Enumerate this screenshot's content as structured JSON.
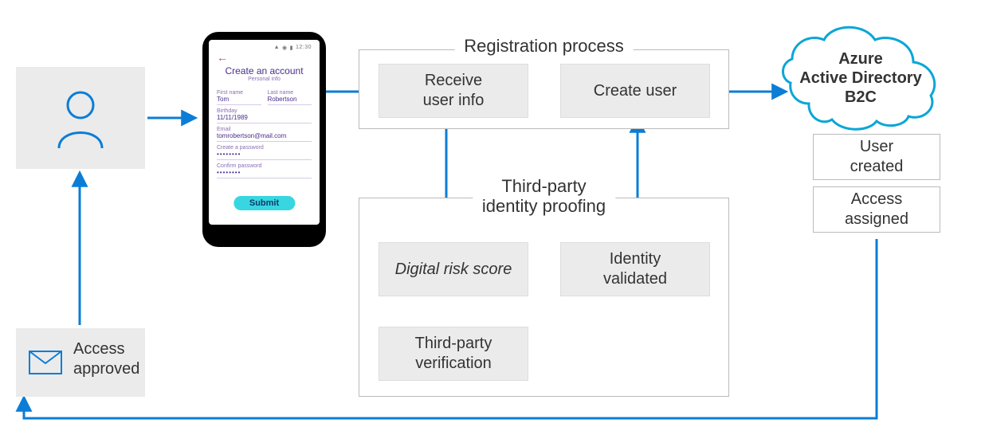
{
  "registration": {
    "title": "Registration process",
    "receive": "Receive\nuser info",
    "create_user": "Create user"
  },
  "proofing": {
    "title": "Third-party\nidentity proofing",
    "risk": "Digital risk score",
    "validated": "Identity\nvalidated",
    "verification": "Third-party\nverification"
  },
  "azure": {
    "title": "Azure\nActive Directory\nB2C",
    "user_created": "User\ncreated",
    "access_assigned": "Access\nassigned"
  },
  "access_approved": "Access\napproved",
  "phone": {
    "status_time": "12:30",
    "title": "Create an account",
    "subtitle": "Personal info",
    "first_name_label": "First name",
    "first_name": "Tom",
    "last_name_label": "Last name",
    "last_name": "Robertson",
    "birthday_label": "Birthday",
    "birthday": "11/11/1989",
    "email_label": "Email",
    "email": "tomrobertson@mail.com",
    "pw_label": "Create a password",
    "pw": "••••••••",
    "cpw_label": "Confirm password",
    "cpw": "••••••••",
    "submit": "Submit"
  }
}
